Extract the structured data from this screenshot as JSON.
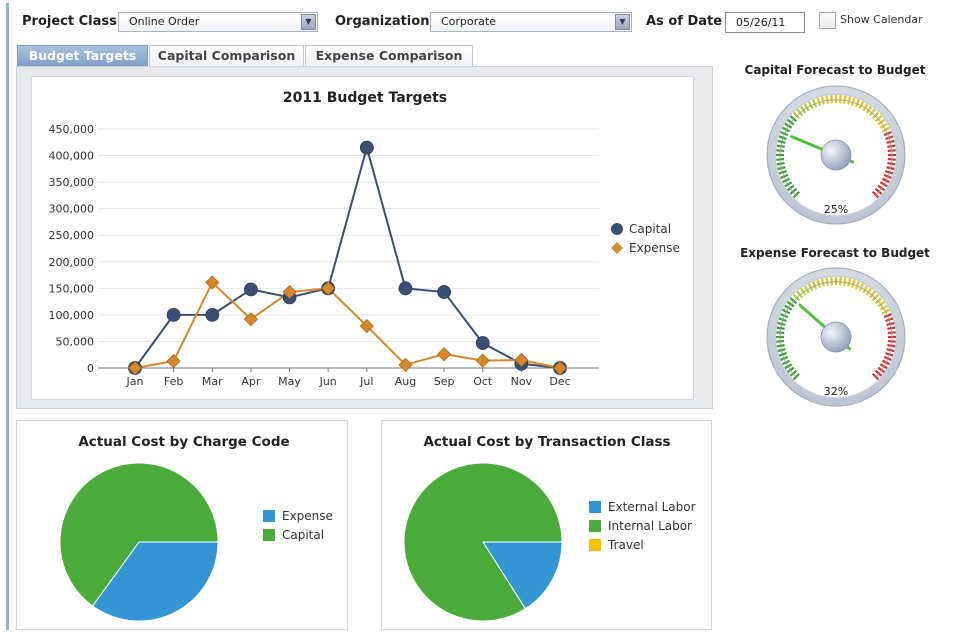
{
  "filters": {
    "project_class": {
      "label": "Project Class",
      "value": "Online Order"
    },
    "organization": {
      "label": "Organization",
      "value": "Corporate"
    },
    "as_of_date": {
      "label": "As of Date",
      "value": "05/26/11"
    },
    "show_calendar_label": "Show Calendar",
    "show_calendar_checked": false
  },
  "tabs": [
    {
      "label": "Budget Targets",
      "active": true
    },
    {
      "label": "Capital Comparison",
      "active": false
    },
    {
      "label": "Expense Comparison",
      "active": false
    }
  ],
  "colors": {
    "capital": "#3b4f75",
    "expense": "#d4882a",
    "pie_blue": "#3396d3",
    "pie_green": "#4aab3a",
    "travel": "#f5c400"
  },
  "chart_data": [
    {
      "type": "line",
      "title": "2011 Budget Targets",
      "categories": [
        "Jan",
        "Feb",
        "Mar",
        "Apr",
        "May",
        "Jun",
        "Jul",
        "Aug",
        "Sep",
        "Oct",
        "Nov",
        "Dec"
      ],
      "ylim": [
        0,
        450000
      ],
      "yticks": [
        "450,000",
        "400,000",
        "350,000",
        "300,000",
        "250,000",
        "200,000",
        "150,000",
        "100,000",
        "50,000",
        "0"
      ],
      "grid": true,
      "legend": "right",
      "series": [
        {
          "name": "Capital",
          "marker": "circle",
          "values": [
            0,
            100000,
            100000,
            148000,
            133000,
            150000,
            415000,
            150000,
            143000,
            47000,
            8000,
            0
          ]
        },
        {
          "name": "Expense",
          "marker": "diamond",
          "values": [
            0,
            13000,
            161000,
            92000,
            143000,
            150000,
            79000,
            6000,
            26000,
            14000,
            15000,
            0
          ]
        }
      ]
    },
    {
      "type": "pie",
      "title": "Actual Cost by Charge Code",
      "legend": "right",
      "labels": [
        "Expense",
        "Capital"
      ],
      "values": [
        35,
        65
      ]
    },
    {
      "type": "pie",
      "title": "Actual Cost by Transaction Class",
      "legend": "right",
      "labels": [
        "External Labor",
        "Internal Labor",
        "Travel"
      ],
      "values": [
        16,
        84,
        0
      ]
    }
  ],
  "gauges": [
    {
      "title": "Capital Forecast to Budget",
      "value": 25,
      "label": "25%"
    },
    {
      "title": "Expense Forecast to Budget",
      "value": 32,
      "label": "32%"
    }
  ]
}
